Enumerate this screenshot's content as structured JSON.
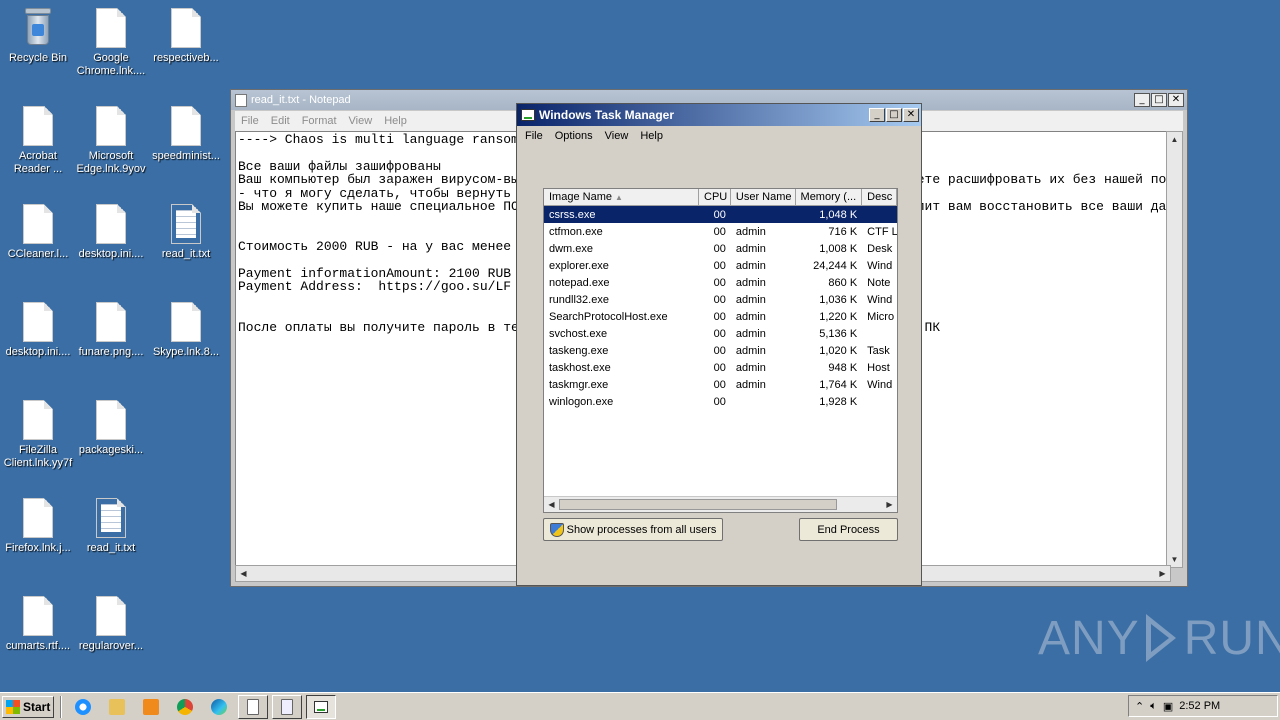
{
  "desktop": {
    "icons": [
      {
        "label": "Recycle Bin",
        "kind": "recycle-bin"
      },
      {
        "label": "Google Chrome.lnk....",
        "kind": "doc"
      },
      {
        "label": "respectiveb...",
        "kind": "doc"
      },
      {
        "label": "Acrobat Reader ...",
        "kind": "doc"
      },
      {
        "label": "Microsoft Edge.lnk.9yov",
        "kind": "doc"
      },
      {
        "label": "speedminist...",
        "kind": "doc"
      },
      {
        "label": "CCleaner.l...",
        "kind": "doc"
      },
      {
        "label": "desktop.ini....",
        "kind": "doc"
      },
      {
        "label": "read_it.txt",
        "kind": "text"
      },
      {
        "label": "desktop.ini....",
        "kind": "doc"
      },
      {
        "label": "funare.png....",
        "kind": "doc"
      },
      {
        "label": "Skype.lnk.8...",
        "kind": "doc"
      },
      {
        "label": "FileZilla Client.lnk.yy7f",
        "kind": "doc"
      },
      {
        "label": "packageski...",
        "kind": "doc"
      },
      {
        "label": "Firefox.lnk.j...",
        "kind": "doc"
      },
      {
        "label": "read_it.txt",
        "kind": "text"
      },
      {
        "label": "cumarts.rtf....",
        "kind": "doc"
      },
      {
        "label": "regularover...",
        "kind": "doc"
      }
    ]
  },
  "notepad": {
    "title": "read_it.txt - Notepad",
    "menu": [
      "File",
      "Edit",
      "Format",
      "View",
      "Help"
    ],
    "content": "----> Chaos is multi language ransomware. Translate your note to any language <----\n\nВсе ваши файлы зашифрованы\nВаш компьютер был заражен вирусом-вымогателем. Ваши файлы были зашифрованы, и вы не можете расшифровать их без нашей помощи.\n- что я могу сделать, чтобы вернуть свои файлы?\nВы можете купить наше специальное ПО для расшифровки, это программное обеспечение позволит вам восстановить все ваши данные\n\n\nСтоимость 2000 RUB - на у вас менее\n\nPayment informationAmount: 2100 RUB\nPayment Address:  https://goo.su/LF\n\n\nПосле оплаты вы получите пароль в текстовом файле                                     а ПК"
  },
  "taskmgr": {
    "title": "Windows Task Manager",
    "menu": [
      "File",
      "Options",
      "View",
      "Help"
    ],
    "columns": [
      "Image Name",
      "CPU",
      "User Name",
      "Memory (...",
      "Desc"
    ],
    "rows": [
      {
        "name": "csrss.exe",
        "cpu": "00",
        "user": "",
        "mem": "1,048 K",
        "desc": "",
        "selected": true
      },
      {
        "name": "ctfmon.exe",
        "cpu": "00",
        "user": "admin",
        "mem": "716 K",
        "desc": "CTF L"
      },
      {
        "name": "dwm.exe",
        "cpu": "00",
        "user": "admin",
        "mem": "1,008 K",
        "desc": "Desk"
      },
      {
        "name": "explorer.exe",
        "cpu": "00",
        "user": "admin",
        "mem": "24,244 K",
        "desc": "Wind"
      },
      {
        "name": "notepad.exe",
        "cpu": "00",
        "user": "admin",
        "mem": "860 K",
        "desc": "Note"
      },
      {
        "name": "rundll32.exe",
        "cpu": "00",
        "user": "admin",
        "mem": "1,036 K",
        "desc": "Wind"
      },
      {
        "name": "SearchProtocolHost.exe",
        "cpu": "00",
        "user": "admin",
        "mem": "1,220 K",
        "desc": "Micro"
      },
      {
        "name": "svchost.exe",
        "cpu": "00",
        "user": "admin",
        "mem": "5,136 K",
        "desc": ""
      },
      {
        "name": "taskeng.exe",
        "cpu": "00",
        "user": "admin",
        "mem": "1,020 K",
        "desc": "Task"
      },
      {
        "name": "taskhost.exe",
        "cpu": "00",
        "user": "admin",
        "mem": "948 K",
        "desc": "Host"
      },
      {
        "name": "taskmgr.exe",
        "cpu": "00",
        "user": "admin",
        "mem": "1,764 K",
        "desc": "Wind"
      },
      {
        "name": "winlogon.exe",
        "cpu": "00",
        "user": "",
        "mem": "1,928 K",
        "desc": ""
      }
    ],
    "show_all_label": "Show processes from all users",
    "end_process_label": "End Process"
  },
  "watermark": {
    "left": "ANY",
    "right": "RUN"
  },
  "taskbar": {
    "start_label": "Start",
    "clock": "2:52 PM"
  },
  "colors": {
    "desktop": "#3a6ea5",
    "selection": "#0a246a"
  }
}
